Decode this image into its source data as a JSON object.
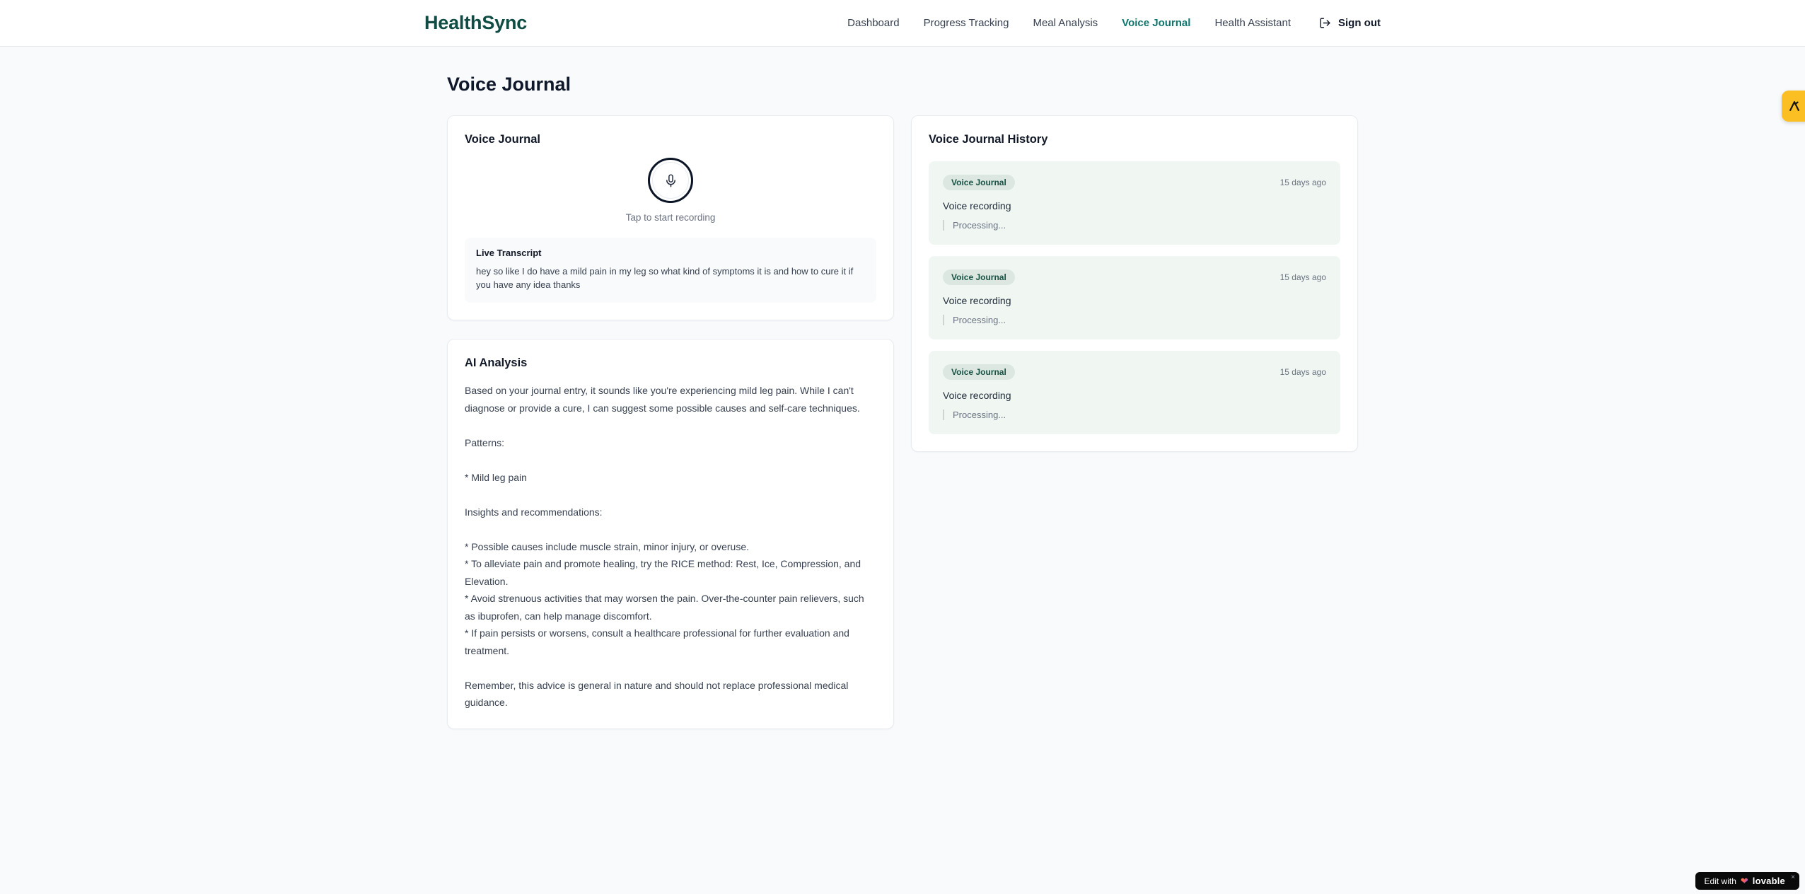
{
  "brand": {
    "name": "HealthSync"
  },
  "nav": {
    "items": [
      {
        "label": "Dashboard",
        "active": false
      },
      {
        "label": "Progress Tracking",
        "active": false
      },
      {
        "label": "Meal Analysis",
        "active": false
      },
      {
        "label": "Voice Journal",
        "active": true
      },
      {
        "label": "Health Assistant",
        "active": false
      }
    ],
    "sign_out_label": "Sign out"
  },
  "page": {
    "title": "Voice Journal"
  },
  "recorder_card": {
    "title": "Voice Journal",
    "tap_hint": "Tap to start recording",
    "transcript": {
      "title": "Live Transcript",
      "text": "hey so like I do have a mild pain in my leg so what kind of symptoms it is and how to cure it if you have any idea thanks"
    }
  },
  "analysis_card": {
    "title": "AI Analysis",
    "body": "Based on your journal entry, it sounds like you're experiencing mild leg pain. While I can't diagnose or provide a cure, I can suggest some possible causes and self-care techniques.\n\nPatterns:\n\n* Mild leg pain\n\nInsights and recommendations:\n\n* Possible causes include muscle strain, minor injury, or overuse.\n* To alleviate pain and promote healing, try the RICE method: Rest, Ice, Compression, and Elevation.\n* Avoid strenuous activities that may worsen the pain. Over-the-counter pain relievers, such as ibuprofen, can help manage discomfort.\n* If pain persists or worsens, consult a healthcare professional for further evaluation and treatment.\n\nRemember, this advice is general in nature and should not replace professional medical guidance."
  },
  "history_card": {
    "title": "Voice Journal History",
    "entries": [
      {
        "badge": "Voice Journal",
        "time": "15 days ago",
        "label": "Voice recording",
        "status": "Processing..."
      },
      {
        "badge": "Voice Journal",
        "time": "15 days ago",
        "label": "Voice recording",
        "status": "Processing..."
      },
      {
        "badge": "Voice Journal",
        "time": "15 days ago",
        "label": "Voice recording",
        "status": "Processing..."
      }
    ]
  },
  "floating": {
    "lovable_badge": {
      "prefix": "Edit with",
      "brand": "lovable",
      "close": "×"
    }
  },
  "colors": {
    "brand_teal": "#0f4c44",
    "active_nav": "#0f766e",
    "entry_bg": "#f0f7f2",
    "badge_bg": "#dbe7e0",
    "badge_text": "#175244",
    "accent_amber": "#fbbf24"
  }
}
